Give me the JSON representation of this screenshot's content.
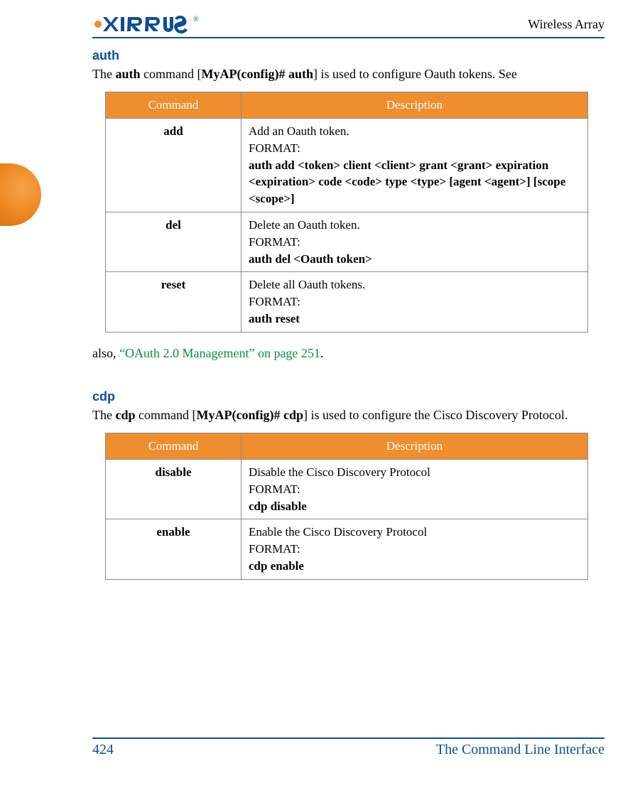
{
  "header": {
    "logo_text": "XIRRUS",
    "doc_title": "Wireless Array"
  },
  "sections": {
    "auth": {
      "heading": "auth",
      "intro_pre": "The ",
      "intro_cmd": "auth",
      "intro_mid": " command [",
      "intro_prompt": "MyAP(config)# auth",
      "intro_post": "] is used to configure Oauth tokens. See",
      "also_pre": "also, ",
      "also_link": "“OAuth 2.0 Management” on page 251",
      "also_post": "."
    },
    "cdp": {
      "heading": "cdp",
      "intro_pre": "The ",
      "intro_cmd": "cdp",
      "intro_mid": " command [",
      "intro_prompt": "MyAP(config)# cdp",
      "intro_post": "] is used to configure the Cisco Discovery Protocol."
    }
  },
  "table_headers": {
    "command": "Command",
    "description": "Description"
  },
  "auth_table": [
    {
      "cmd": "add",
      "desc": "Add an Oauth token.",
      "fmt_label": "FORMAT:",
      "fmt": "auth add <token> client <client> grant <grant> expiration <expiration> code <code> type <type> [agent <agent>] [scope <scope>]"
    },
    {
      "cmd": "del",
      "desc": "Delete an Oauth token.",
      "fmt_label": "FORMAT:",
      "fmt": "auth del <Oauth token>"
    },
    {
      "cmd": "reset",
      "desc": "Delete all Oauth tokens.",
      "fmt_label": "FORMAT:",
      "fmt": "auth reset"
    }
  ],
  "cdp_table": [
    {
      "cmd": "disable",
      "desc": "Disable the Cisco Discovery Protocol",
      "fmt_label": "FORMAT:",
      "fmt": "cdp disable"
    },
    {
      "cmd": "enable",
      "desc": "Enable the Cisco Discovery Protocol",
      "fmt_label": "FORMAT:",
      "fmt": "cdp enable"
    }
  ],
  "footer": {
    "page_number": "424",
    "chapter": "The Command Line Interface"
  }
}
